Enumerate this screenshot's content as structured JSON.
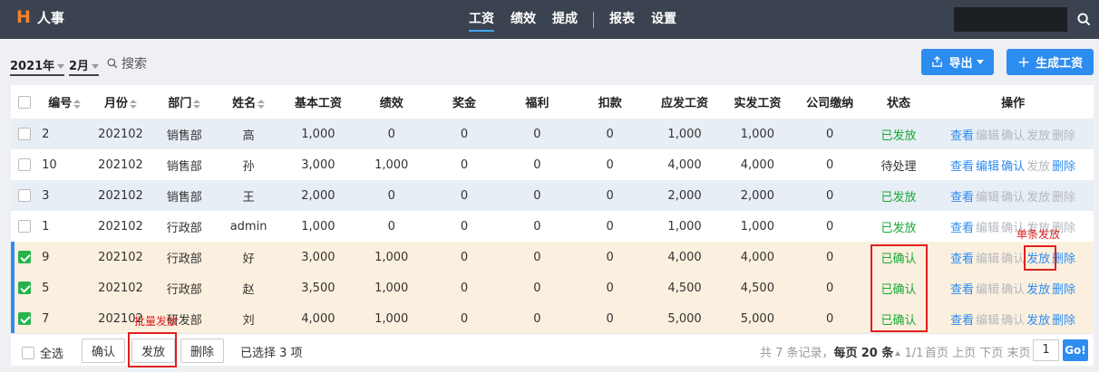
{
  "app": {
    "logo": "H",
    "title": "人事"
  },
  "nav": [
    "工资",
    "绩效",
    "提成",
    "报表",
    "设置"
  ],
  "toolbar": {
    "year": "2021年",
    "month": "2月",
    "search": "搜索",
    "export": "导出",
    "generate": "生成工资"
  },
  "table": {
    "headers": [
      "编号",
      "月份",
      "部门",
      "姓名",
      "基本工资",
      "绩效",
      "奖金",
      "福利",
      "扣款",
      "应发工资",
      "实发工资",
      "公司缴纳",
      "状态",
      "操作"
    ],
    "ops": [
      "查看",
      "编辑",
      "确认",
      "发放",
      "删除"
    ],
    "rows": [
      {
        "id": "2",
        "month": "202102",
        "dept": "销售部",
        "name": "高",
        "base": "1,000",
        "perf": "0",
        "bonus": "0",
        "welfare": "0",
        "deduct": "0",
        "gross": "1,000",
        "net": "1,000",
        "company": "0",
        "status": "已发放",
        "checked": false,
        "selected": false,
        "enabled": [
          true,
          false,
          false,
          false,
          false
        ]
      },
      {
        "id": "10",
        "month": "202102",
        "dept": "销售部",
        "name": "孙",
        "base": "3,000",
        "perf": "1,000",
        "bonus": "0",
        "welfare": "0",
        "deduct": "0",
        "gross": "4,000",
        "net": "4,000",
        "company": "0",
        "status": "待处理",
        "checked": false,
        "selected": false,
        "enabled": [
          true,
          true,
          true,
          false,
          true
        ]
      },
      {
        "id": "3",
        "month": "202102",
        "dept": "销售部",
        "name": "王",
        "base": "2,000",
        "perf": "0",
        "bonus": "0",
        "welfare": "0",
        "deduct": "0",
        "gross": "2,000",
        "net": "2,000",
        "company": "0",
        "status": "已发放",
        "checked": false,
        "selected": false,
        "enabled": [
          true,
          false,
          false,
          false,
          false
        ]
      },
      {
        "id": "1",
        "month": "202102",
        "dept": "行政部",
        "name": "admin",
        "base": "1,000",
        "perf": "0",
        "bonus": "0",
        "welfare": "0",
        "deduct": "0",
        "gross": "1,000",
        "net": "1,000",
        "company": "0",
        "status": "已发放",
        "checked": false,
        "selected": false,
        "enabled": [
          true,
          false,
          false,
          false,
          false
        ]
      },
      {
        "id": "9",
        "month": "202102",
        "dept": "行政部",
        "name": "好",
        "base": "3,000",
        "perf": "1,000",
        "bonus": "0",
        "welfare": "0",
        "deduct": "0",
        "gross": "4,000",
        "net": "4,000",
        "company": "0",
        "status": "已确认",
        "checked": true,
        "selected": true,
        "enabled": [
          true,
          false,
          false,
          true,
          true
        ]
      },
      {
        "id": "5",
        "month": "202102",
        "dept": "行政部",
        "name": "赵",
        "base": "3,500",
        "perf": "1,000",
        "bonus": "0",
        "welfare": "0",
        "deduct": "0",
        "gross": "4,500",
        "net": "4,500",
        "company": "0",
        "status": "已确认",
        "checked": true,
        "selected": true,
        "enabled": [
          true,
          false,
          false,
          true,
          true
        ]
      },
      {
        "id": "7",
        "month": "202102",
        "dept": "研发部",
        "name": "刘",
        "base": "4,000",
        "perf": "1,000",
        "bonus": "0",
        "welfare": "0",
        "deduct": "0",
        "gross": "5,000",
        "net": "5,000",
        "company": "0",
        "status": "已确认",
        "checked": true,
        "selected": true,
        "enabled": [
          true,
          false,
          false,
          true,
          true
        ]
      }
    ]
  },
  "footer": {
    "select_all": "全选",
    "confirm": "确认",
    "issue": "发放",
    "delete": "删除",
    "selected_info": "已选择 3 项",
    "pager_prefix": "共 7 条记录，",
    "per_page_label": "每页",
    "per_page": "20",
    "per_page_unit": "条",
    "pages": "1/1",
    "first": "首页",
    "prev": "上页",
    "next": "下页",
    "last": "末页",
    "page_input": "1",
    "go": "Go!"
  },
  "annotations": {
    "single": "单条发放",
    "batch": "批量发放"
  }
}
